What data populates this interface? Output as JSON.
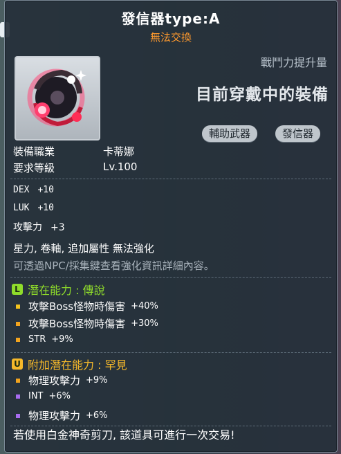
{
  "item": {
    "name": "發信器type:A",
    "trade_status": "無法交換",
    "power_label": "戰鬥力提升量",
    "equipped_text": "目前穿戴中的裝備",
    "tags": [
      "輔助武器",
      "發信器"
    ]
  },
  "requirements": [
    {
      "label": "裝備職業",
      "value": "卡蒂娜"
    },
    {
      "label": "要求等級",
      "value": "Lv.100"
    }
  ],
  "stats": [
    {
      "name": "DEX",
      "value": "+10"
    },
    {
      "name": "LUK",
      "value": "+10"
    },
    {
      "name": "攻擊力",
      "value": "+3"
    }
  ],
  "notes": {
    "no_enhance": "星力, 卷軸, 追加屬性 無法強化",
    "hint": "可透過NPC/採集鍵查看強化資訊詳細內容。"
  },
  "potential": {
    "badge": "L",
    "title": "潛在能力 : 傳說",
    "color": "#8fdc2b",
    "options": [
      {
        "text": "攻擊Boss怪物時傷害",
        "value": "+40%",
        "bullet": "#f3c31e"
      },
      {
        "text": "攻擊Boss怪物時傷害",
        "value": "+30%",
        "bullet": "#f3a41e"
      },
      {
        "text": "STR",
        "value": "+9%",
        "bullet": "#f3a41e"
      }
    ]
  },
  "bonus_potential": {
    "badge": "U",
    "title": "附加潛在能力 : 罕見",
    "color": "#f5b82a",
    "options": [
      {
        "text": "物理攻擊力",
        "value": "+9%",
        "bullet": "#f3a41e"
      },
      {
        "text": "INT",
        "value": "+6%",
        "bullet": "#a86cf0"
      },
      {
        "text": "物理攻擊力",
        "value": "+6%",
        "bullet": "#a86cf0"
      }
    ]
  },
  "footer": "若使用白金神奇剪刀, 該道具可進行一次交易!"
}
